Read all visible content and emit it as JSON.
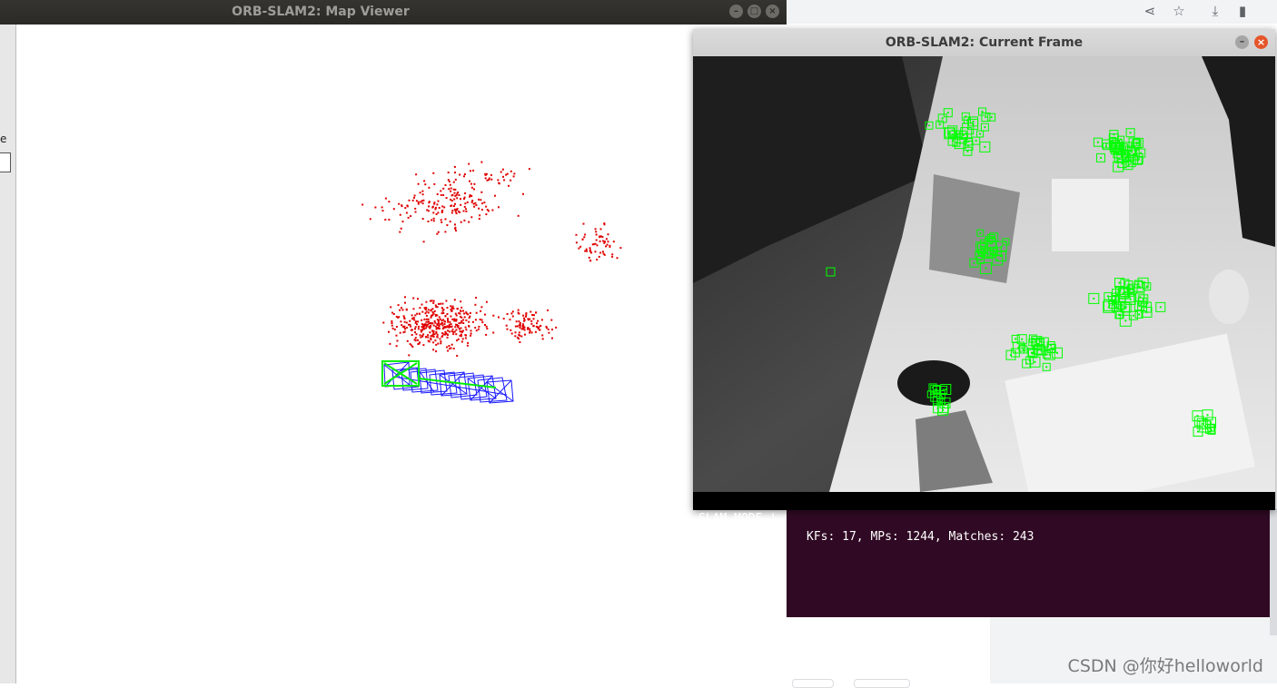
{
  "map_viewer": {
    "title": "ORB-SLAM2: Map Viewer",
    "window_buttons": [
      "–",
      "□",
      "×"
    ],
    "panel_label": "e"
  },
  "current_frame": {
    "title": "ORB-SLAM2: Current Frame",
    "window_buttons": [
      "–",
      "×"
    ],
    "status_mode": "SLAM MODE |",
    "status_stats": "KFs: 17, MPs: 1244, Matches: 243"
  },
  "browser": {
    "toolbar_icons": [
      "share-icon",
      "star-icon",
      "download-icon",
      "extension-icon"
    ]
  },
  "watermark": "CSDN @你好helloworld",
  "colors": {
    "map_point": "#e00000",
    "keyframe": "#1a1aff",
    "current_camera": "#00ee00",
    "feature_box": "#00ff00",
    "terminal": "#300a24"
  }
}
